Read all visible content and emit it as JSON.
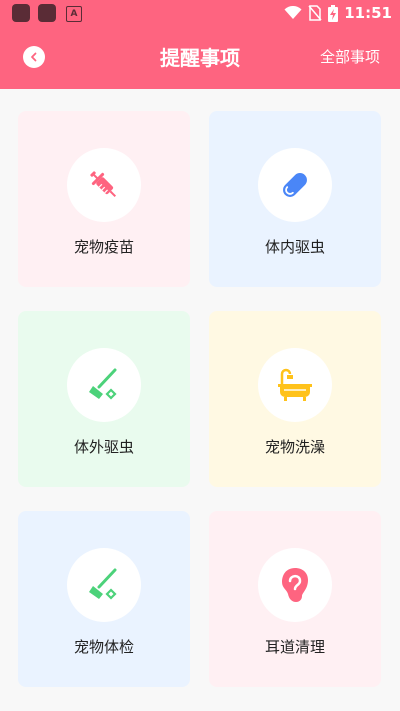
{
  "status_bar": {
    "time": "11:51",
    "notification_glyph": "A",
    "icons": [
      "app-icon",
      "app-icon",
      "notification-icon",
      "wifi-icon",
      "no-sim-icon",
      "battery-charging-icon"
    ]
  },
  "header": {
    "title": "提醒事项",
    "right_link": "全部事项",
    "back_icon": "chevron-left-icon",
    "background": "#fe6480"
  },
  "cards": [
    {
      "label": "宠物疫苗",
      "icon": "syringe-icon",
      "icon_color": "#fe6480",
      "bg": "#fff0f3"
    },
    {
      "label": "体内驱虫",
      "icon": "pill-icon",
      "icon_color": "#4a86f7",
      "bg": "#eaf3ff"
    },
    {
      "label": "体外驱虫",
      "icon": "flea-comb-icon",
      "icon_color": "#4cd27a",
      "bg": "#e9fbee"
    },
    {
      "label": "宠物洗澡",
      "icon": "bathtub-icon",
      "icon_color": "#ffc21a",
      "bg": "#fff9e3"
    },
    {
      "label": "宠物体检",
      "icon": "flea-comb-icon",
      "icon_color": "#4cd27a",
      "bg": "#eaf3ff"
    },
    {
      "label": "耳道清理",
      "icon": "ear-icon",
      "icon_color": "#fe6480",
      "bg": "#fff0f3"
    }
  ]
}
